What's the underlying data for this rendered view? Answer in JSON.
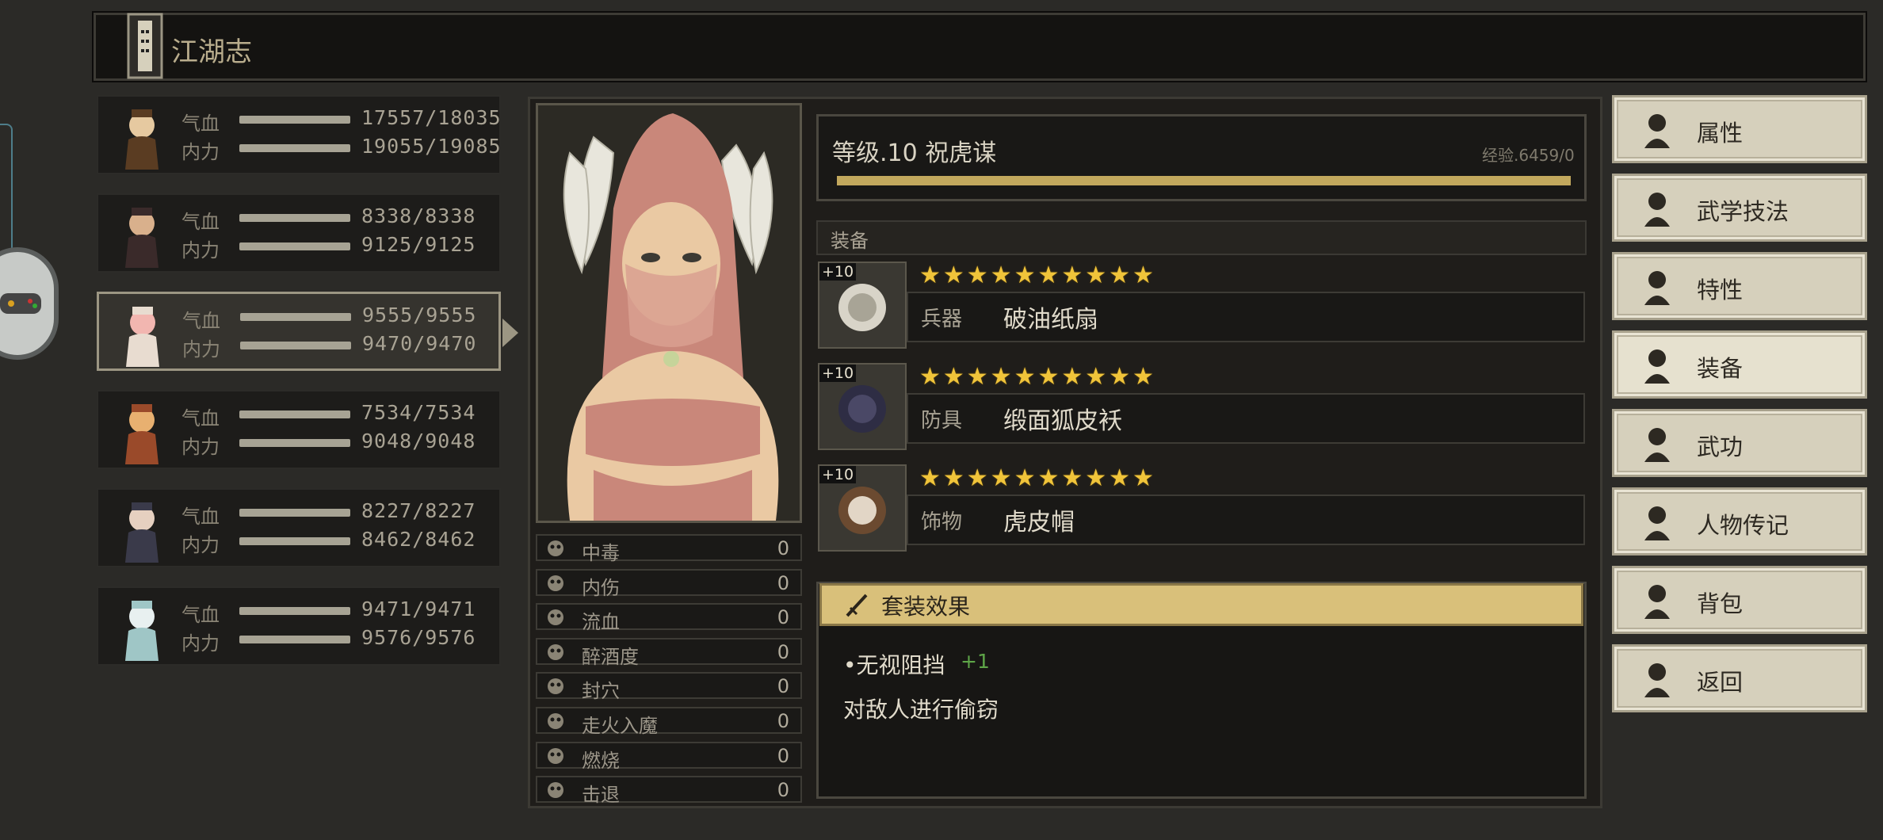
{
  "header": {
    "title": "江湖志",
    "book_icon": "scroll-book-icon"
  },
  "party": [
    {
      "hp_label": "气血",
      "mp_label": "内力",
      "hp": "17557/18035",
      "mp": "19055/19085",
      "selected": false
    },
    {
      "hp_label": "气血",
      "mp_label": "内力",
      "hp": "8338/8338",
      "mp": "9125/9125",
      "selected": false
    },
    {
      "hp_label": "气血",
      "mp_label": "内力",
      "hp": "9555/9555",
      "mp": "9470/9470",
      "selected": true
    },
    {
      "hp_label": "气血",
      "mp_label": "内力",
      "hp": "7534/7534",
      "mp": "9048/9048",
      "selected": false
    },
    {
      "hp_label": "气血",
      "mp_label": "内力",
      "hp": "8227/8227",
      "mp": "8462/8462",
      "selected": false
    },
    {
      "hp_label": "气血",
      "mp_label": "内力",
      "hp": "9471/9471",
      "mp": "9576/9576",
      "selected": false
    }
  ],
  "character": {
    "level_text": "等级.10 祝虎谋",
    "exp_text": "经验.6459/0",
    "exp_fill": 1.0
  },
  "status": [
    {
      "name": "中毒",
      "value": "0",
      "icon": "skull-icon"
    },
    {
      "name": "内伤",
      "value": "0",
      "icon": "broken-heart-icon"
    },
    {
      "name": "流血",
      "value": "0",
      "icon": "blood-drop-icon"
    },
    {
      "name": "醉酒度",
      "value": "0",
      "icon": "drunk-face-icon"
    },
    {
      "name": "封穴",
      "value": "0",
      "icon": "acupoint-seal-icon"
    },
    {
      "name": "走火入魔",
      "value": "0",
      "icon": "demon-skull-icon"
    },
    {
      "name": "燃烧",
      "value": "0",
      "icon": "fire-icon"
    },
    {
      "name": "击退",
      "value": "0",
      "icon": "boot-icon"
    }
  ],
  "equipment": {
    "header": "装备",
    "items": [
      {
        "plus": "+10",
        "type": "兵器",
        "name": "破油纸扇",
        "stars": 10,
        "icon": "paper-fan-icon"
      },
      {
        "plus": "+10",
        "type": "防具",
        "name": "缎面狐皮袄",
        "stars": 10,
        "icon": "fur-coat-icon"
      },
      {
        "plus": "+10",
        "type": "饰物",
        "name": "虎皮帽",
        "stars": 10,
        "icon": "tiger-hat-icon"
      }
    ]
  },
  "set_effect": {
    "title": "套装效果",
    "effect_name": "•无视阻挡",
    "effect_bonus": "+1",
    "description": "对敌人进行偷窃"
  },
  "menu": [
    {
      "label": "属性",
      "icon": "character-attributes-icon",
      "active": false
    },
    {
      "label": "武学技法",
      "icon": "martial-arts-icon",
      "active": false
    },
    {
      "label": "特性",
      "icon": "trait-icon",
      "active": false
    },
    {
      "label": "装备",
      "icon": "sword-icon",
      "active": true
    },
    {
      "label": "武功",
      "icon": "skill-book-icon",
      "active": false
    },
    {
      "label": "人物传记",
      "icon": "biography-scroll-icon",
      "active": false
    },
    {
      "label": "背包",
      "icon": "bag-icon",
      "active": false
    },
    {
      "label": "返回",
      "icon": "door-icon",
      "active": false
    }
  ],
  "colors": {
    "star": "#f0c43a",
    "exp_bar": "#c2a85d",
    "bonus_green": "#5ea548",
    "set_header": "#d9c07a"
  }
}
